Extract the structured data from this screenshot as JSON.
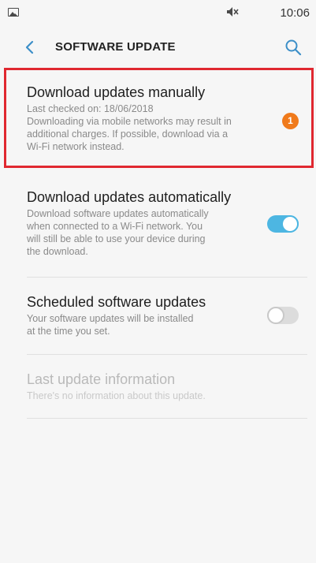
{
  "status_bar": {
    "time": "10:06",
    "left_icon": "gallery-icon",
    "right_icon": "mute-icon"
  },
  "app_bar": {
    "title": "SOFTWARE UPDATE",
    "back_icon": "chevron-left-icon",
    "search_icon": "search-icon"
  },
  "colors": {
    "accent": "#4db6e2",
    "badge": "#f07a1b",
    "highlight": "#e02830"
  },
  "items": [
    {
      "title": "Download updates manually",
      "subtitle_lines": [
        "Last checked on: 18/06/2018",
        "Downloading via mobile networks may result in",
        "additional charges. If possible, download via a",
        "Wi-Fi network instead."
      ],
      "badge": "1"
    },
    {
      "title": "Download updates automatically",
      "subtitle_lines": [
        "Download software updates automatically",
        "when connected to a Wi-Fi network. You",
        "will still be able to use your device during",
        "the download."
      ],
      "toggle_on": true
    },
    {
      "title": "Scheduled software updates",
      "subtitle_lines": [
        "Your software updates will be installed",
        "at the time you set."
      ],
      "toggle_on": false
    },
    {
      "title": "Last update information",
      "subtitle_lines": [
        "There's no information about this update."
      ],
      "disabled": true
    }
  ]
}
